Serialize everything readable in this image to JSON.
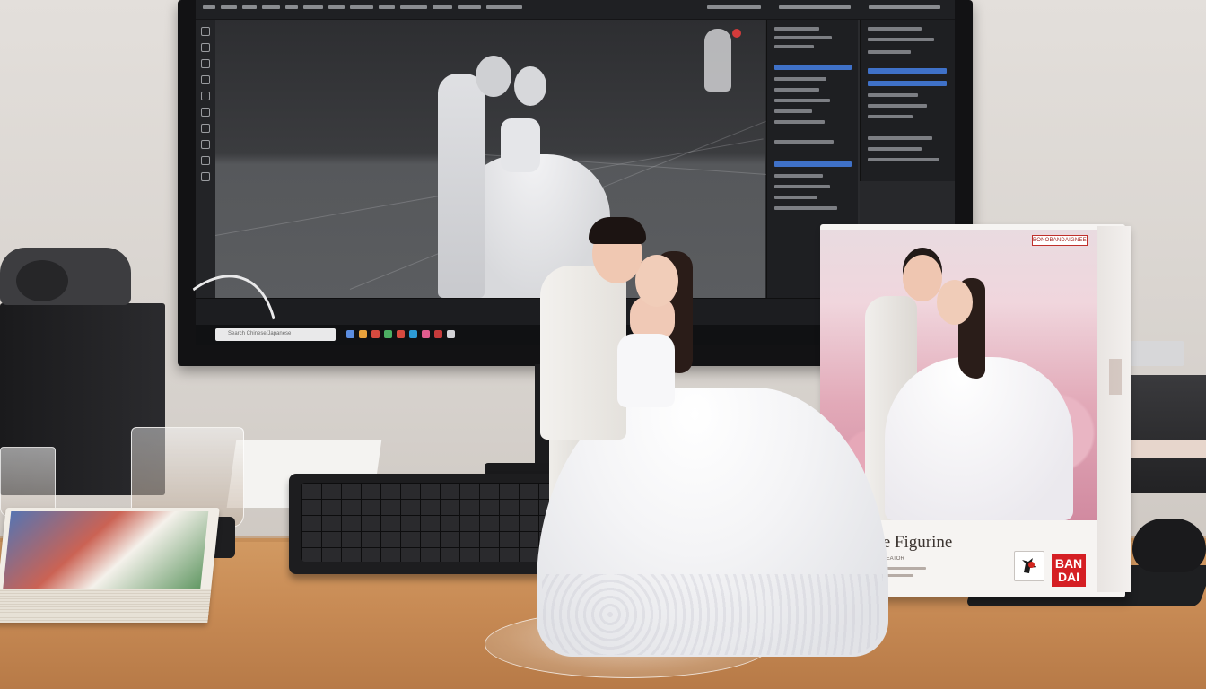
{
  "screen": {
    "taskbar": {
      "search_placeholder": "Search Chinese/Japanese"
    },
    "colors": {
      "selection": "#3f71c8",
      "viewport_bg": "#2d2e31"
    }
  },
  "product_box": {
    "brand_tag": "BONOBANDAIGNEERE",
    "title": "1/7 Scale Figurine",
    "fine_print": "BEAU COLLECTIVE CREATOR",
    "logo": "BAN DAI",
    "logo_lines": [
      "BAN",
      "DAI"
    ],
    "colors": {
      "logo_red": "#d51f24",
      "flowers": "#e2a9b8"
    }
  },
  "figurine": {
    "colors": {
      "gown": "#f4f4f6",
      "suit": "#f3f1ee"
    }
  }
}
